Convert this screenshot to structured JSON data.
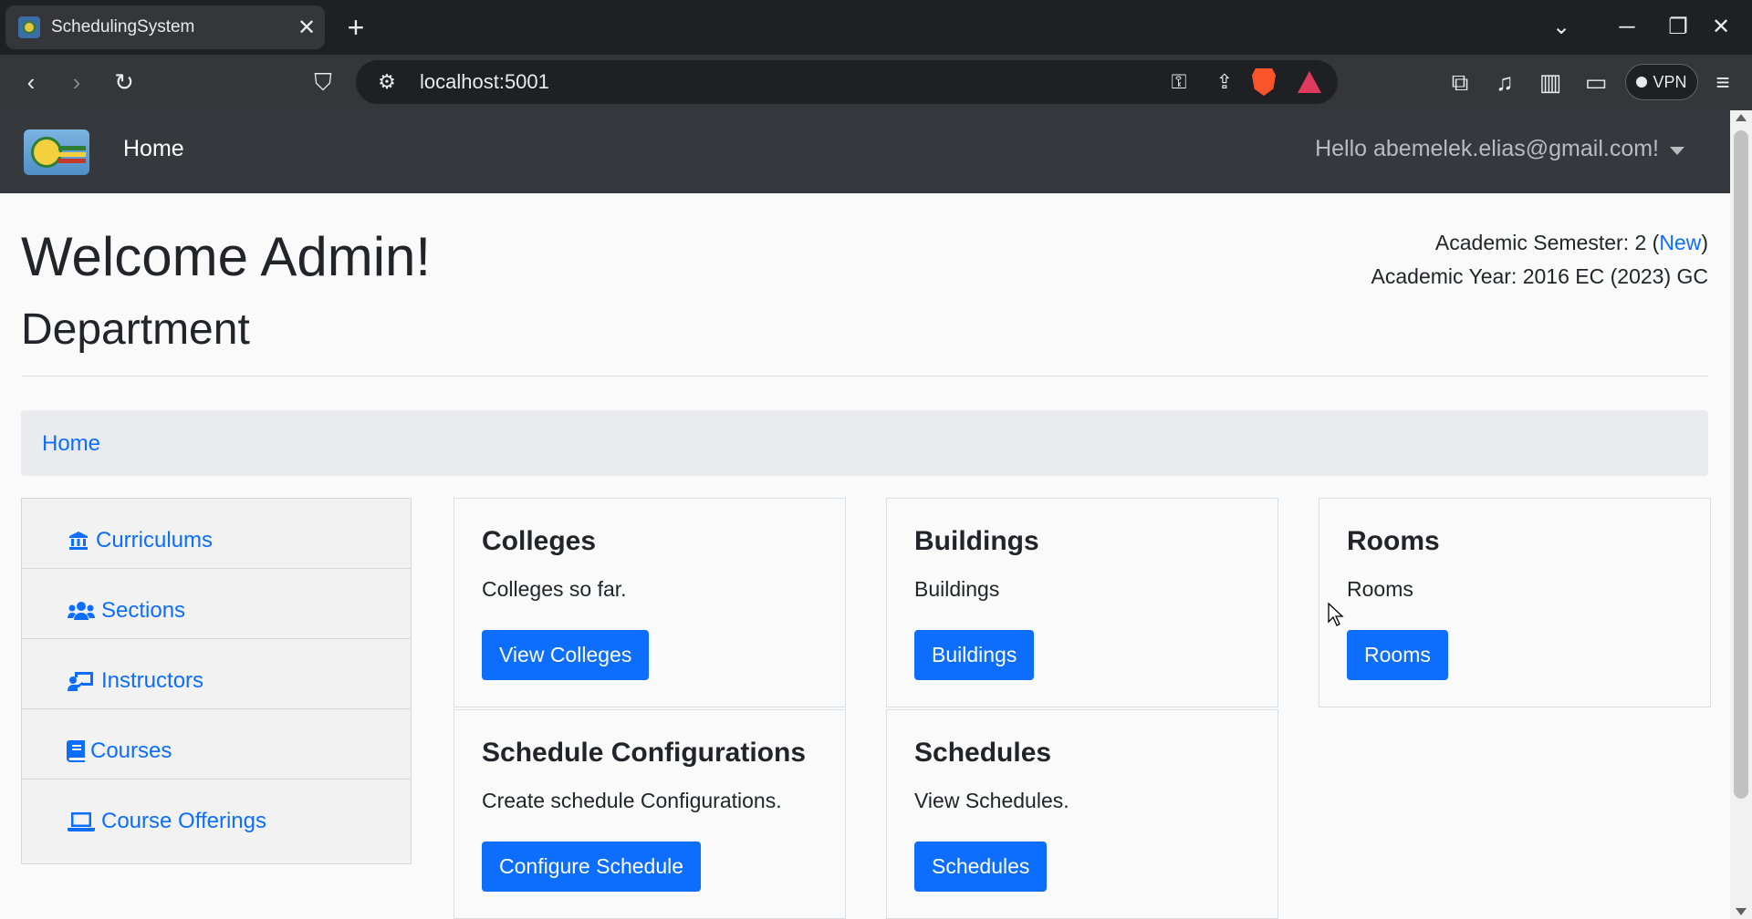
{
  "browser": {
    "tab_title": "SchedulingSystem",
    "tab_close_icon": "close-icon",
    "url": "localhost:5001",
    "vpn_label": "VPN"
  },
  "navbar": {
    "brand_label": "Home",
    "user_greeting": "Hello abemelek.elias@gmail.com!"
  },
  "header": {
    "welcome": "Welcome Admin!",
    "department": "Department",
    "semester_label": "Academic Semester: 2 (",
    "semester_link": "New",
    "semester_suffix": ")",
    "year_label": "Academic Year: 2016 EC (2023) GC"
  },
  "breadcrumb": {
    "home": "Home"
  },
  "sidebar": {
    "items": [
      {
        "label": "Curriculums",
        "icon": "building-columns-icon"
      },
      {
        "label": "Sections",
        "icon": "users-icon"
      },
      {
        "label": "Instructors",
        "icon": "chalkboard-teacher-icon"
      },
      {
        "label": "Courses",
        "icon": "book-icon"
      },
      {
        "label": "Course Offerings",
        "icon": "laptop-icon"
      }
    ]
  },
  "cards": [
    {
      "title": "Colleges",
      "text": "Colleges so far.",
      "button": "View Colleges"
    },
    {
      "title": "Buildings",
      "text": "Buildings",
      "button": "Buildings"
    },
    {
      "title": "Rooms",
      "text": "Rooms",
      "button": "Rooms"
    },
    {
      "title": "Schedule Configurations",
      "text": "Create schedule Configurations.",
      "button": "Configure Schedule"
    },
    {
      "title": "Schedules",
      "text": "View Schedules.",
      "button": "Schedules"
    }
  ],
  "colors": {
    "primary": "#0d6efd",
    "navbar_bg": "#35393d",
    "page_bg": "#fafafa"
  }
}
